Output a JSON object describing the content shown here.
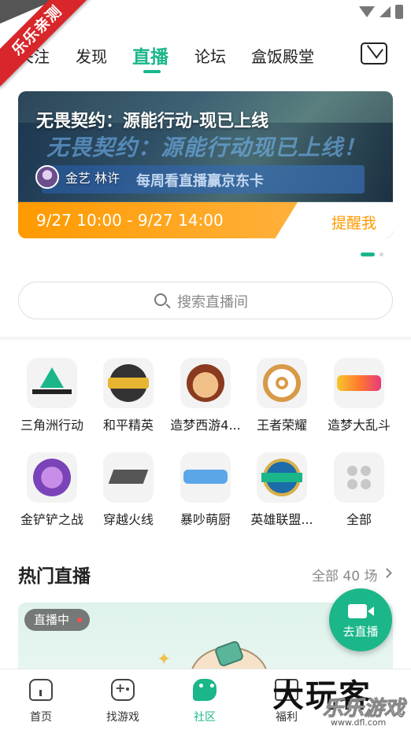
{
  "watermark": {
    "ribbon": "乐乐亲测",
    "logo_big": "大玩客",
    "logo_small": "乐乐游戏",
    "url": "www.dfl.com"
  },
  "tabs": [
    {
      "label": "关注",
      "active": false
    },
    {
      "label": "发现",
      "active": false
    },
    {
      "label": "直播",
      "active": true
    },
    {
      "label": "论坛",
      "active": false
    },
    {
      "label": "盒饭殿堂",
      "active": false
    }
  ],
  "mail_icon": "mail-icon",
  "banner": {
    "title": "无畏契约：源能行动-现已上线",
    "art_text": "无畏契约：源能行动现已上线！",
    "art_strip": "每周看直播赢京东卡",
    "streamer": "金艺 林许",
    "time": "9/27 10:00 - 9/27 14:00",
    "remind": "提醒我"
  },
  "search": {
    "placeholder": "搜索直播间"
  },
  "games": [
    {
      "label": "三角洲行动",
      "icon": "delta-force-icon"
    },
    {
      "label": "和平精英",
      "icon": "peace-elite-icon"
    },
    {
      "label": "造梦西游4...",
      "icon": "dream-journey-icon"
    },
    {
      "label": "王者荣耀",
      "icon": "honor-of-kings-icon"
    },
    {
      "label": "造梦大乱斗",
      "icon": "dream-brawl-icon"
    },
    {
      "label": "金铲铲之战",
      "icon": "golden-spatula-icon"
    },
    {
      "label": "穿越火线",
      "icon": "crossfire-icon"
    },
    {
      "label": "暴吵萌厨",
      "icon": "cute-chef-icon"
    },
    {
      "label": "英雄联盟...",
      "icon": "league-of-legends-icon"
    },
    {
      "label": "全部",
      "icon": "all-grid-icon"
    }
  ],
  "hot": {
    "title": "热门直播",
    "all": "全部 40 场",
    "badge": "直播中"
  },
  "fab": {
    "label": "去直播"
  },
  "nav": [
    {
      "label": "首页",
      "active": false
    },
    {
      "label": "找游戏",
      "active": false
    },
    {
      "label": "社区",
      "active": true
    },
    {
      "label": "福利",
      "active": false
    }
  ],
  "colors": {
    "accent": "#1bb68a",
    "orange": "#ff9a00"
  }
}
